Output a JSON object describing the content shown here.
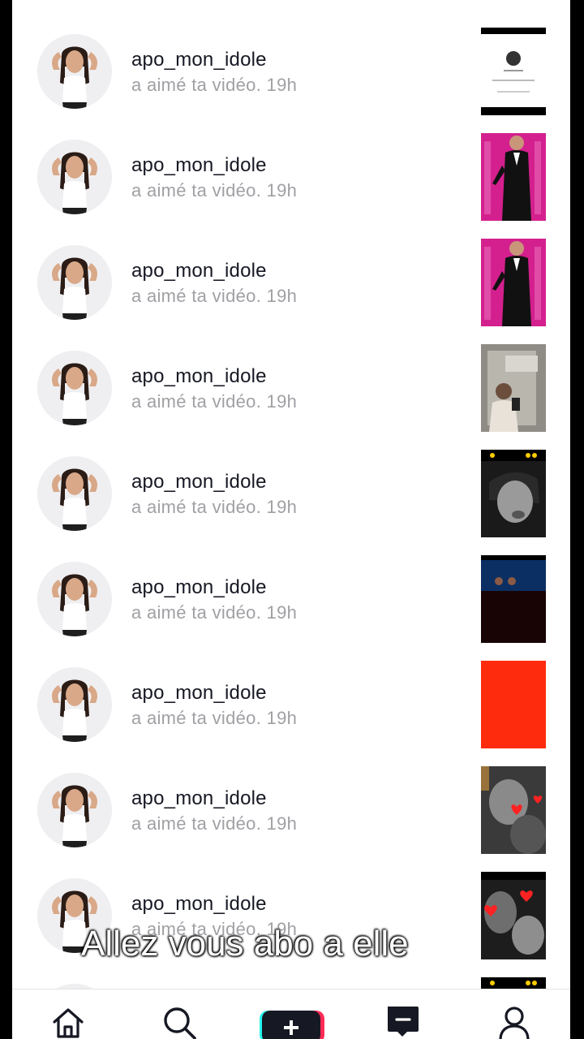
{
  "notifications": [
    {
      "username": "apo_mon_idole",
      "action": "a aimé ta vidéo.",
      "time": "19h",
      "thumb": "profile-screenshot"
    },
    {
      "username": "apo_mon_idole",
      "action": "a aimé ta vidéo.",
      "time": "19h",
      "thumb": "tuxedo-pink"
    },
    {
      "username": "apo_mon_idole",
      "action": "a aimé ta vidéo.",
      "time": "19h",
      "thumb": "tuxedo-pink"
    },
    {
      "username": "apo_mon_idole",
      "action": "a aimé ta vidéo.",
      "time": "19h",
      "thumb": "mirror-selfie"
    },
    {
      "username": "apo_mon_idole",
      "action": "a aimé ta vidéo.",
      "time": "19h",
      "thumb": "bw-portrait"
    },
    {
      "username": "apo_mon_idole",
      "action": "a aimé ta vidéo.",
      "time": "19h",
      "thumb": "dark-stage"
    },
    {
      "username": "apo_mon_idole",
      "action": "a aimé ta vidéo.",
      "time": "19h",
      "thumb": "red-solid"
    },
    {
      "username": "apo_mon_idole",
      "action": "a aimé ta vidéo.",
      "time": "19h",
      "thumb": "bw-hearts"
    },
    {
      "username": "apo_mon_idole",
      "action": "a aimé ta vidéo.",
      "time": "19h",
      "thumb": "bw-hearts-2"
    }
  ],
  "overlay": {
    "caption": "Allez vous abo a elle"
  },
  "tabbar": {
    "items": [
      "home-icon",
      "search-icon",
      "create-plus-icon",
      "inbox-icon",
      "profile-icon"
    ]
  },
  "colors": {
    "pink": "#d4208e",
    "red": "#fe2c0c",
    "text": "#161823",
    "muted": "#a0a0a5"
  }
}
